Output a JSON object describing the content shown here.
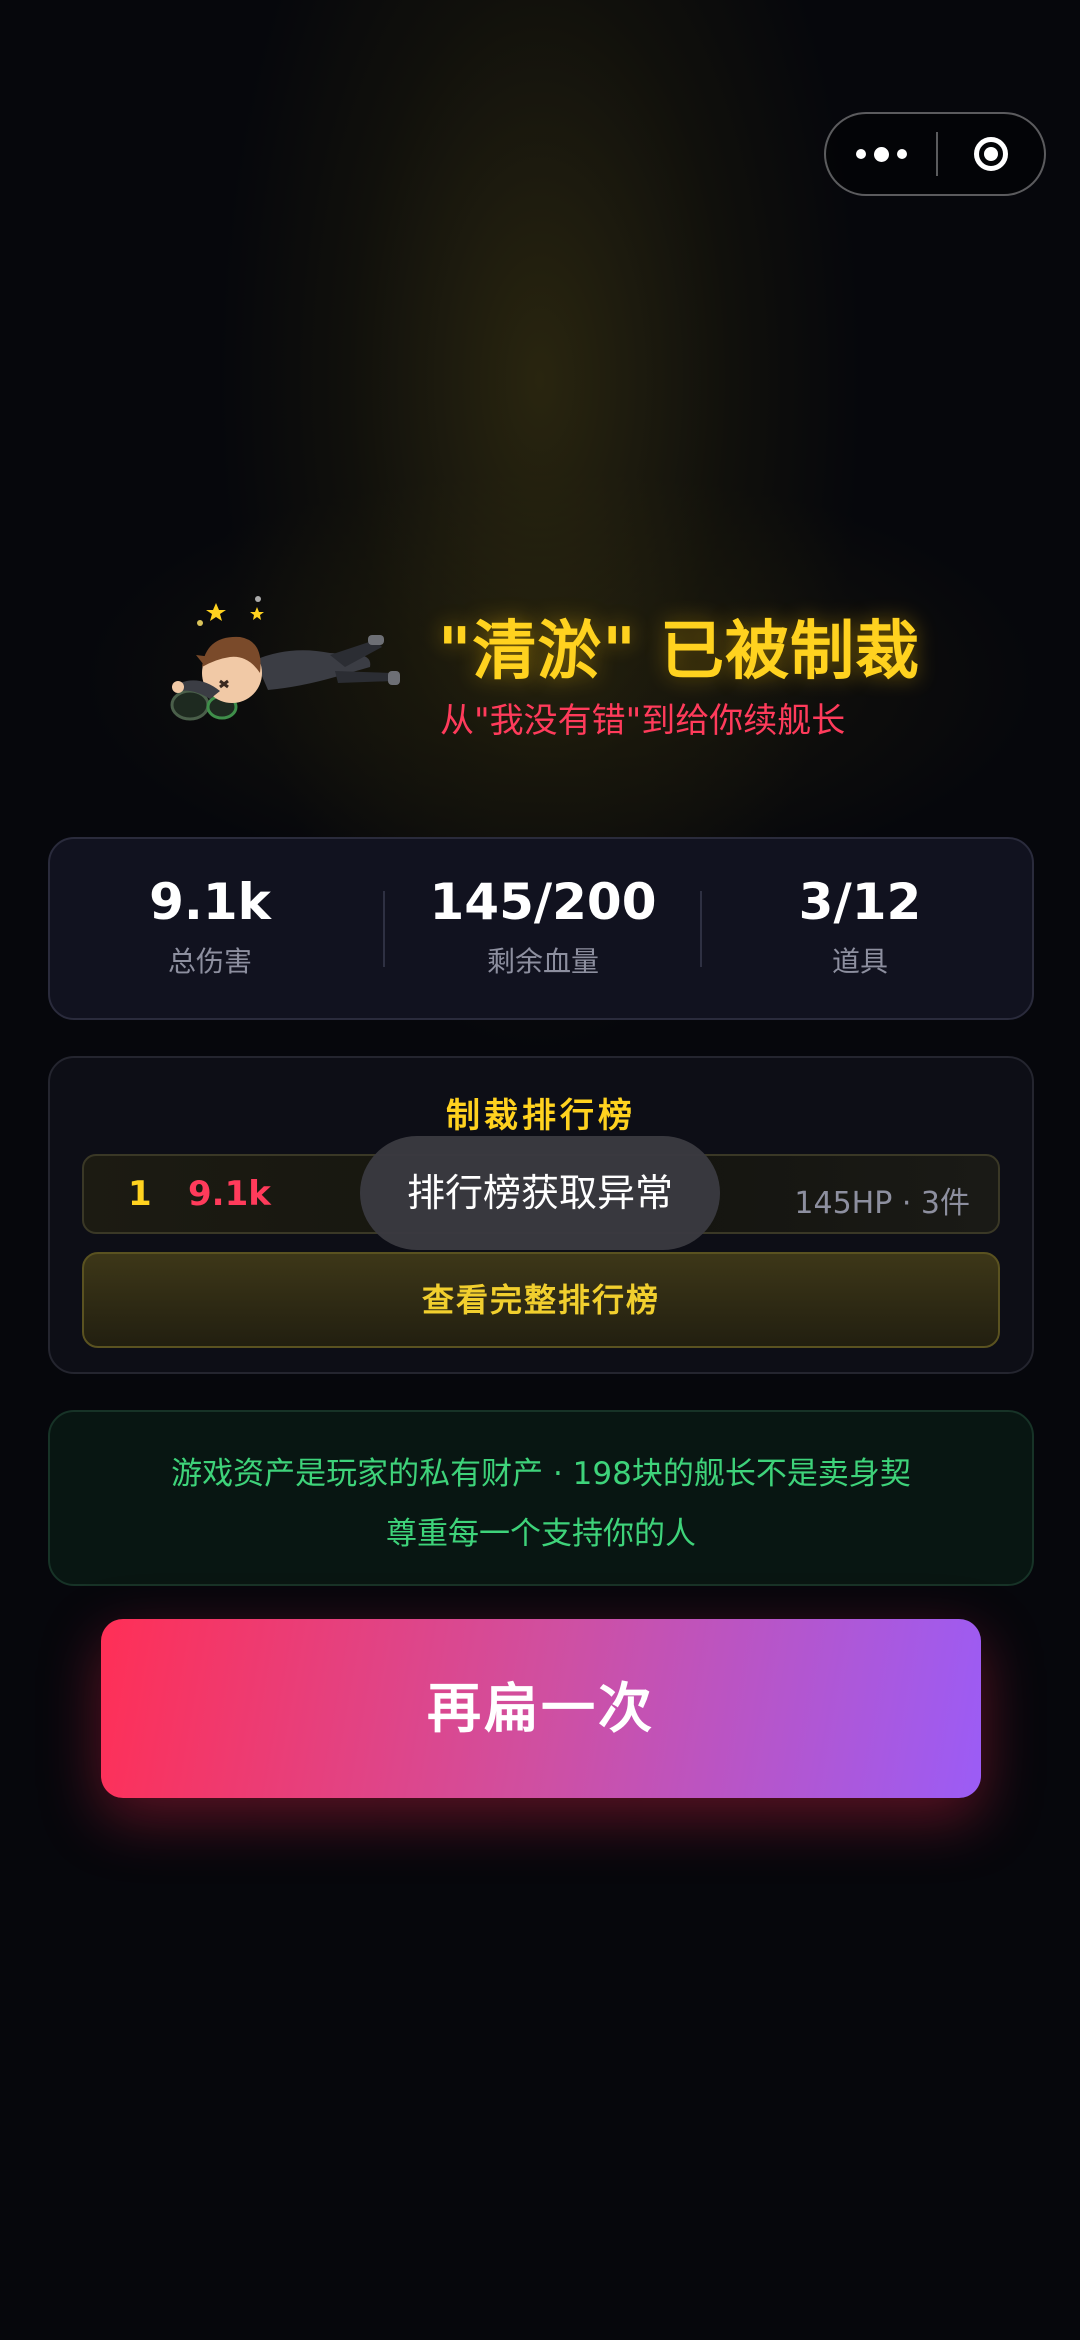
{
  "capsule": {
    "more_icon": "more-dots-icon",
    "close_icon": "target-close-icon"
  },
  "hero": {
    "title": "\"清淤\" 已被制裁",
    "subtitle": "从\"我没有错\"到给你续舰长",
    "figure_icon": "knocked-out-character-icon"
  },
  "stats": [
    {
      "value": "9.1k",
      "label": "总伤害"
    },
    {
      "value": "145/200",
      "label": "剩余血量"
    },
    {
      "value": "3/12",
      "label": "道具"
    }
  ],
  "ranking": {
    "title": "制裁排行榜",
    "rows": [
      {
        "rank": "1",
        "damage": "9.1k",
        "meta": "145HP · 3件"
      }
    ],
    "full_button": "查看完整排行榜"
  },
  "toast": {
    "text": "排行榜获取异常"
  },
  "notice": {
    "line1": "游戏资产是玩家的私有财产 · 198块的舰长不是卖身契",
    "line2": "尊重每一个支持你的人"
  },
  "retry": {
    "label": "再扁一次"
  },
  "colors": {
    "accent_yellow": "#ffd21f",
    "accent_red": "#ff3b5b",
    "notice_green": "#3ed37a",
    "button_gradient_start": "#ff2f56",
    "button_gradient_end": "#9b5cf6",
    "background": "#06070c"
  }
}
